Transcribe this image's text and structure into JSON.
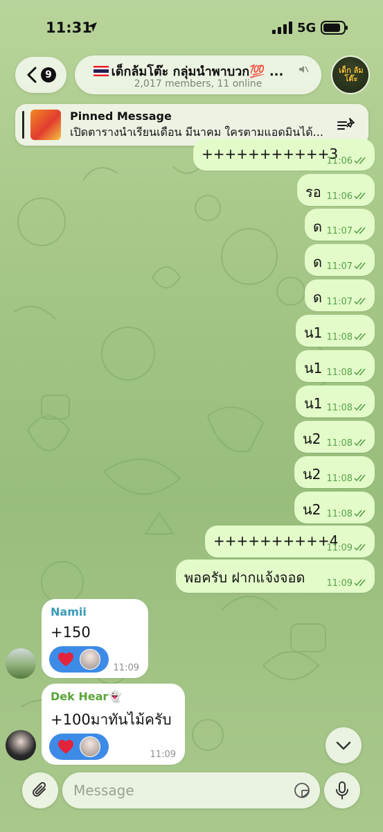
{
  "status_bar": {
    "time": "11:31",
    "network": "5G"
  },
  "header": {
    "back_count": "9",
    "title": "เด็กล้มโต๊ะ กลุ่มนำพาบวก💯 ...",
    "subtitle": "2,017 members, 11 online",
    "group_avatar_text": "เด็ก ล้มโต๊ะ"
  },
  "pinned": {
    "title": "Pinned Message",
    "text": "เปิดตารางนำเรียนเดือน มีนาคม ใครตามแอดมินได้..."
  },
  "messages": [
    {
      "text": "+++++++++++3",
      "time": "11:06"
    },
    {
      "text": "รอ",
      "time": "11:06"
    },
    {
      "text": "ด",
      "time": "11:07"
    },
    {
      "text": "ด",
      "time": "11:07"
    },
    {
      "text": "ด",
      "time": "11:07"
    },
    {
      "text": "น1",
      "time": "11:08"
    },
    {
      "text": "น1",
      "time": "11:08"
    },
    {
      "text": "น1",
      "time": "11:08"
    },
    {
      "text": "น2",
      "time": "11:08"
    },
    {
      "text": "น2",
      "time": "11:08"
    },
    {
      "text": "น2",
      "time": "11:08"
    },
    {
      "text": "++++++++++4",
      "time": "11:09"
    },
    {
      "text": "พอครับ ฝากแจ้งจอด",
      "time": "11:09"
    }
  ],
  "incoming": [
    {
      "name": "Namii",
      "name_color": "#3a9bb8",
      "text": "+150",
      "time": "11:09",
      "reaction": "heart"
    },
    {
      "name": "Dek Hear👻",
      "name_color": "#5aa63a",
      "text": "+100มาทันไม้ครับ",
      "time": "11:09",
      "reaction": "heart"
    }
  ],
  "input": {
    "placeholder": "Message"
  },
  "icons": {
    "back": "chevron-left-icon",
    "mute": "muted-speaker-icon",
    "pinned_list": "pinned-list-icon",
    "scroll": "chevron-down-icon",
    "attach": "paperclip-icon",
    "sticker": "sticker-icon",
    "mic": "microphone-icon"
  },
  "colors": {
    "outgoing_bubble": "#e2fbc9",
    "check": "#5aa04a",
    "reaction": "#3d8be6",
    "background": "#a3c585"
  }
}
